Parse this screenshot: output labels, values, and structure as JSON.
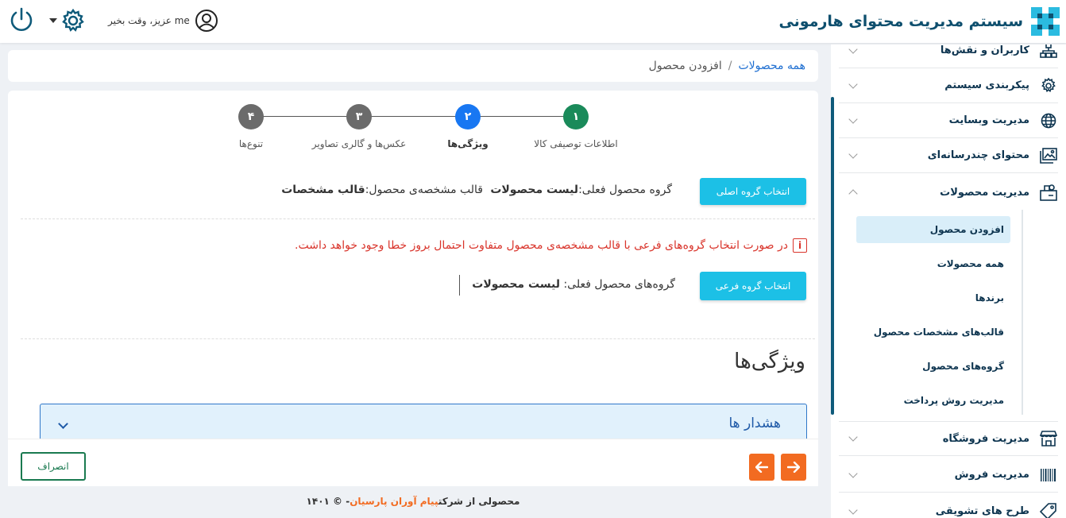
{
  "header": {
    "app_title": "سیستم مدیریت محتوای هارمونی",
    "greeting": "me عزیز، وقت بخیر"
  },
  "sidebar": {
    "items": [
      {
        "label": "کاربران و نقش‌ها",
        "icon": "sitemap-icon"
      },
      {
        "label": "پیکربندی سیستم",
        "icon": "gear-icon"
      },
      {
        "label": "مدیریت وبسایت",
        "icon": "globe-icon"
      },
      {
        "label": "محتوای چندرسانه‌ای",
        "icon": "image-icon"
      },
      {
        "label": "مدیریت محصولات",
        "icon": "products-icon",
        "expanded": true
      },
      {
        "label": "مدیریت فروشگاه",
        "icon": "store-icon"
      },
      {
        "label": "مدیریت فروش",
        "icon": "barcode-icon"
      },
      {
        "label": "طرح های تشویقی",
        "icon": "tag-icon"
      }
    ],
    "submenu": [
      {
        "label": "افزودن محصول",
        "active": true
      },
      {
        "label": "همه محصولات"
      },
      {
        "label": "برندها"
      },
      {
        "label": "قالب‌های مشخصات محصول"
      },
      {
        "label": "گروه‌های محصول"
      },
      {
        "label": "مدیریت روش پرداخت"
      }
    ]
  },
  "breadcrumb": {
    "parent": "همه محصولات",
    "separator": "/",
    "current": "افزودن محصول"
  },
  "stepper": {
    "steps": [
      {
        "num": "۱",
        "label": "اطلاعات توصیفی کالا",
        "color": "#1a8a5a"
      },
      {
        "num": "۲",
        "label": "ویژگی‌ها",
        "color": "#1877f2",
        "current": true
      },
      {
        "num": "۳",
        "label": "عکس‌ها و گالری تصاویر",
        "color": "#6b6b6b"
      },
      {
        "num": "۴",
        "label": "تنوع‌ها",
        "color": "#6b6b6b"
      }
    ]
  },
  "main_group": {
    "button": "انتخاب گروه اصلی",
    "current_label": "گروه محصول فعلی:",
    "current_value": "لیست محصولات",
    "template_label": "قالب مشخصه‌ی محصول:",
    "template_value": "قالب مشخصات"
  },
  "warning": "در صورت انتخاب گروه‌های فرعی با قالب مشخصه‌ی محصول متفاوت احتمال بروز خطا وجود خواهد داشت.",
  "sub_group": {
    "button": "انتخاب گروه فرعی",
    "current_label": "گروه‌های محصول فعلی:",
    "current_value": "لیست محصولات"
  },
  "features": {
    "title": "ویژگی‌ها",
    "accordion_title": "هشدار ها"
  },
  "actions": {
    "cancel": "انصراف"
  },
  "footer": {
    "prefix": "محصولی از شرکت",
    "company": "پیام آوران پارسیان",
    "suffix": "- © ۱۴۰۱"
  },
  "colors": {
    "accent": "#1cc0e6",
    "brand": "#0e4f6e",
    "orange": "#f26b21",
    "danger": "#d9342b"
  }
}
